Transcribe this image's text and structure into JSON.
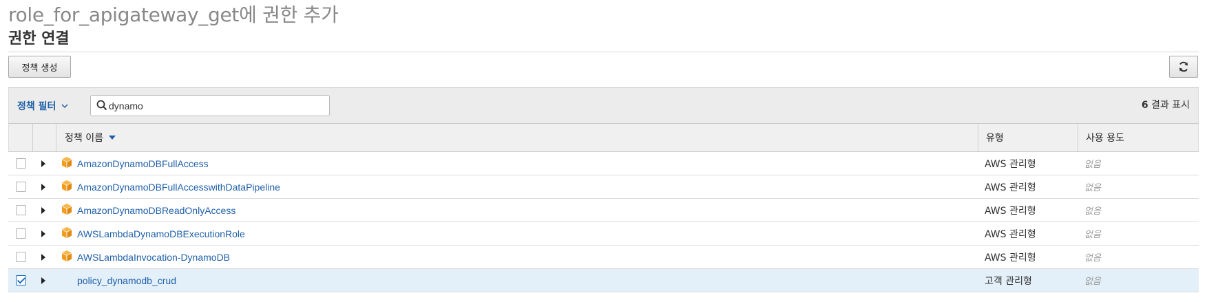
{
  "page": {
    "title": "role_for_apigateway_get에 권한 추가",
    "section_title": "권한 연결"
  },
  "toolbar": {
    "create_policy_label": "정책 생성",
    "refresh_icon": "refresh-icon"
  },
  "filter": {
    "label": "정책 필터",
    "search_value": "dynamo",
    "result_count": "6",
    "result_suffix": " 결과 표시"
  },
  "columns": {
    "name": "정책 이름",
    "type": "유형",
    "usage": "사용 용도"
  },
  "rows": [
    {
      "name": "AmazonDynamoDBFullAccess",
      "type": "AWS 관리형",
      "usage": "없음",
      "checked": false,
      "icon": "aws-managed-policy-icon"
    },
    {
      "name": "AmazonDynamoDBFullAccesswithDataPipeline",
      "type": "AWS 관리형",
      "usage": "없음",
      "checked": false,
      "icon": "aws-managed-policy-icon"
    },
    {
      "name": "AmazonDynamoDBReadOnlyAccess",
      "type": "AWS 관리형",
      "usage": "없음",
      "checked": false,
      "icon": "aws-managed-policy-icon"
    },
    {
      "name": "AWSLambdaDynamoDBExecutionRole",
      "type": "AWS 관리형",
      "usage": "없음",
      "checked": false,
      "icon": "aws-managed-policy-icon"
    },
    {
      "name": "AWSLambdaInvocation-DynamoDB",
      "type": "AWS 관리형",
      "usage": "없음",
      "checked": false,
      "icon": "aws-managed-policy-icon"
    },
    {
      "name": "policy_dynamodb_crud",
      "type": "고객 관리형",
      "usage": "없음",
      "checked": true,
      "icon": ""
    }
  ],
  "colors": {
    "link": "#1f5fa8",
    "aws_icon": "#f29d1f",
    "selected_row": "#e3eff9"
  }
}
